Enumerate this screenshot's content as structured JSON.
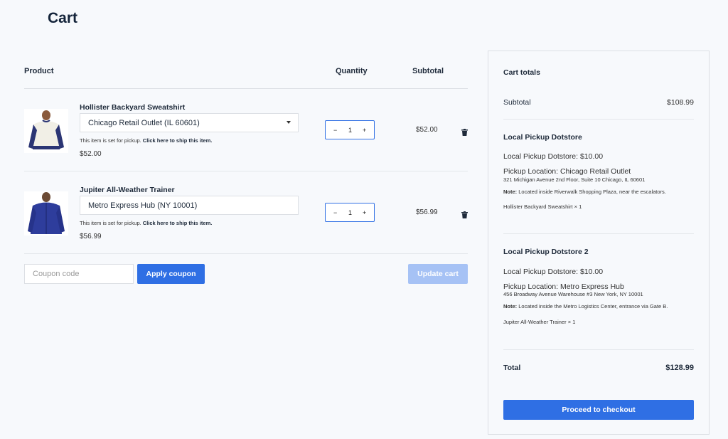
{
  "page": {
    "title": "Cart"
  },
  "table": {
    "headers": {
      "product": "Product",
      "quantity": "Quantity",
      "subtotal": "Subtotal"
    }
  },
  "items": [
    {
      "name": "Hollister Backyard Sweatshirt",
      "location": "Chicago Retail Outlet (IL 60601)",
      "location_is_dropdown": true,
      "pickup_note": "This item is set for pickup.",
      "ship_link": "Click here to ship this item.",
      "price": "$52.00",
      "quantity": "1",
      "subtotal": "$52.00",
      "image": "sweatshirt-image"
    },
    {
      "name": "Jupiter All-Weather Trainer",
      "location": "Metro Express Hub (NY 10001)",
      "location_is_dropdown": false,
      "pickup_note": "This item is set for pickup.",
      "ship_link": "Click here to ship this item.",
      "price": "$56.99",
      "quantity": "1",
      "subtotal": "$56.99",
      "image": "jacket-image"
    }
  ],
  "qty_controls": {
    "minus": "−",
    "plus": "+"
  },
  "coupon": {
    "placeholder": "Coupon code",
    "apply_label": "Apply coupon",
    "update_label": "Update cart"
  },
  "totals": {
    "title": "Cart totals",
    "subtotal_label": "Subtotal",
    "subtotal_value": "$108.99",
    "shipping": [
      {
        "title": "Local Pickup Dotstore",
        "method": "Local Pickup Dotstore: $10.00",
        "location": "Pickup Location: Chicago Retail Outlet",
        "address": "321 Michigan Avenue 2nd Floor, Suite 10 Chicago, IL 60601",
        "note_label": "Note:",
        "note": "Located inside Riverwalk Shopping Plaza, near the escalators.",
        "item": "Hollister Backyard Sweatshirt × 1"
      },
      {
        "title": "Local Pickup Dotstore 2",
        "method": "Local Pickup Dotstore: $10.00",
        "location": "Pickup Location: Metro Express Hub",
        "address": "456 Broadway Avenue Warehouse #3 New York, NY 10001",
        "note_label": "Note:",
        "note": "Located inside the Metro Logistics Center, entrance via Gate B.",
        "item": "Jupiter All-Weather Trainer × 1"
      }
    ],
    "total_label": "Total",
    "total_value": "$128.99",
    "checkout_label": "Proceed to checkout"
  },
  "colors": {
    "accent": "#2f6fe4",
    "accent_disabled": "#a6c2f5",
    "text": "#1e2a3a",
    "background": "#f7f9fc"
  },
  "icons": {
    "delete": "trash-icon",
    "dropdown": "chevron-down-icon"
  }
}
